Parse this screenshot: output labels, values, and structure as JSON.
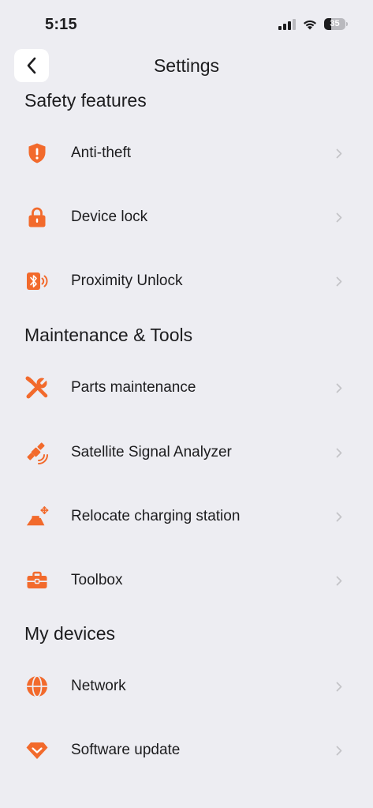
{
  "status_bar": {
    "time": "5:15",
    "battery_level": "35"
  },
  "header": {
    "title": "Settings",
    "back_icon": "chevron-left-icon"
  },
  "colors": {
    "accent": "#F26A2C",
    "background": "#EDEDF2",
    "chevron": "#C4C4C8"
  },
  "sections": [
    {
      "title": "Safety features",
      "items": [
        {
          "label": "Anti-theft",
          "icon": "shield-alert-icon"
        },
        {
          "label": "Device lock",
          "icon": "lock-icon"
        },
        {
          "label": "Proximity Unlock",
          "icon": "bluetooth-unlock-icon"
        }
      ]
    },
    {
      "title": "Maintenance & Tools",
      "items": [
        {
          "label": "Parts maintenance",
          "icon": "wrench-screwdriver-icon"
        },
        {
          "label": "Satellite Signal Analyzer",
          "icon": "satellite-icon"
        },
        {
          "label": "Relocate charging station",
          "icon": "charging-station-move-icon"
        },
        {
          "label": "Toolbox",
          "icon": "toolbox-icon"
        }
      ]
    },
    {
      "title": "My devices",
      "items": [
        {
          "label": "Network",
          "icon": "globe-icon"
        },
        {
          "label": "Software update",
          "icon": "diamond-update-icon"
        }
      ]
    }
  ]
}
